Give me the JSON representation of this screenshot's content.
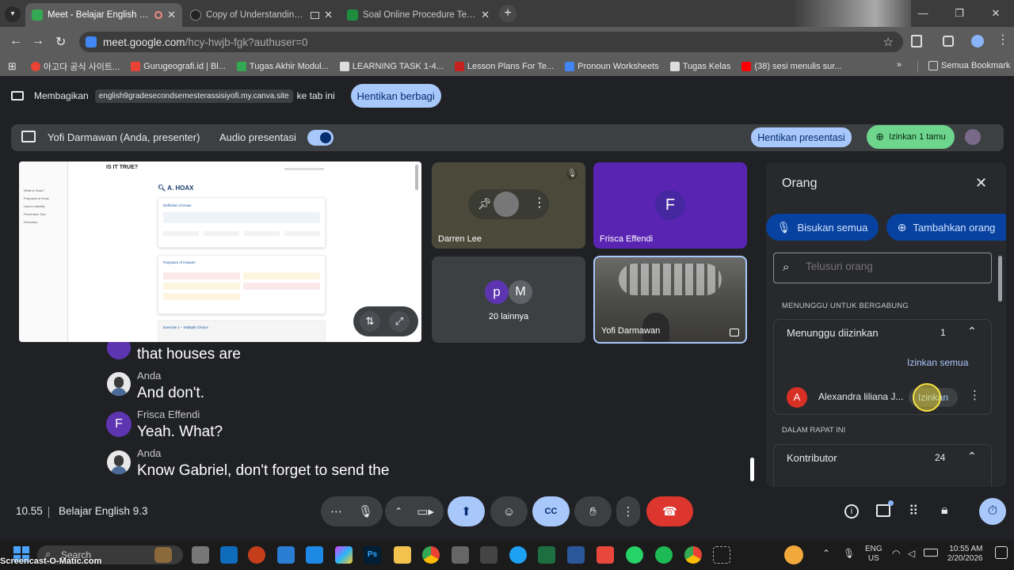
{
  "browser": {
    "tabs": [
      {
        "title": "Meet - Belajar English 9.3",
        "active": true,
        "color": "#34a853"
      },
      {
        "title": "Copy of Understanding Ho",
        "active": false,
        "color": "#333333"
      },
      {
        "title": "Soal Online Procedure Text Kela",
        "active": false,
        "color": "#1e8e3e"
      }
    ],
    "url_host": "meet.google.com",
    "url_path": "/hcy-hwjb-fgk?authuser=0",
    "bookmarks": [
      {
        "label": "아고다 공식 사이트...",
        "color": "#ea4335"
      },
      {
        "label": "Gurugeografi.id | Bl...",
        "color": "#ea4335"
      },
      {
        "label": "Tugas Akhir Modul...",
        "color": "#34a853"
      },
      {
        "label": "LEARNING TASK 1-4...",
        "color": "#dddddd"
      },
      {
        "label": "Lesson Plans For Te...",
        "color": "#c5221f"
      },
      {
        "label": "Pronoun Worksheets",
        "color": "#4285f4"
      },
      {
        "label": "Tugas Kelas",
        "color": "#dddddd"
      },
      {
        "label": "(38) sesi menulis sur...",
        "color": "#ff0000"
      }
    ],
    "bookmarks_more": "»",
    "all_bookmarks": "Semua Bookmark"
  },
  "sharebar": {
    "prefix": "Membagikan",
    "site": "english9gradesecondsemesterassisiyofi.my.canva.site",
    "suffix": "ke tab ini",
    "stop_label": "Hentikan berbagi"
  },
  "presenter": {
    "name": "Yofi Darmawan (Anda, presenter)",
    "audio_label": "Audio presentasi",
    "stop_label": "Hentikan presentasi",
    "admit_label": "Izinkan 1 tamu"
  },
  "slide": {
    "title": "IS IT TRUE?",
    "section": "A. HOAX",
    "box1_title": "Definition of Hoax",
    "box2_title": "Purposes of Hoaxes",
    "box3_title": "Exercise 1 – Multiple Choice",
    "sidebar_items": [
      "What is Hoax?",
      "Purposes of Hoax",
      "How to Identify",
      "Prevention Tips",
      "Exercises"
    ]
  },
  "tiles": [
    {
      "name": "Darren Lee"
    },
    {
      "name": "Frisca Effendi",
      "initial": "F"
    },
    {
      "name": "20 lainnya",
      "initials": [
        "p",
        "M"
      ]
    },
    {
      "name": "Yofi Darmawan"
    }
  ],
  "captions": [
    {
      "speaker": "",
      "text": "that houses are"
    },
    {
      "speaker": "Anda",
      "text": "And don't."
    },
    {
      "speaker": "Frisca Effendi",
      "text": "Yeah. What?",
      "initial": "F"
    },
    {
      "speaker": "Anda",
      "text": "Know Gabriel, don't forget to send the"
    }
  ],
  "people": {
    "title": "Orang",
    "mute_all": "Bisukan semua",
    "add_people": "Tambahkan orang",
    "search_placeholder": "Telusuri orang",
    "waiting_section": "MENUNGGU UNTUK BERGABUNG",
    "waiting_group": "Menunggu diizinkan",
    "waiting_count": "1",
    "admit_all": "Izinkan semua",
    "waiting_person": {
      "name": "Alexandra liliana J...",
      "initial": "A",
      "admit": "Izinkan"
    },
    "in_meeting_section": "DALAM RAPAT INI",
    "contributors": "Kontributor",
    "contributors_count": "24"
  },
  "bottom": {
    "time": "10.55",
    "meeting_name": "Belajar English 9.3"
  },
  "taskbar": {
    "search": "Search",
    "lang1": "ENG",
    "lang2": "US",
    "clock_time": "10:55 AM",
    "clock_date": "2/20/2026",
    "watermark": "Screencast-O-Matic.com"
  }
}
